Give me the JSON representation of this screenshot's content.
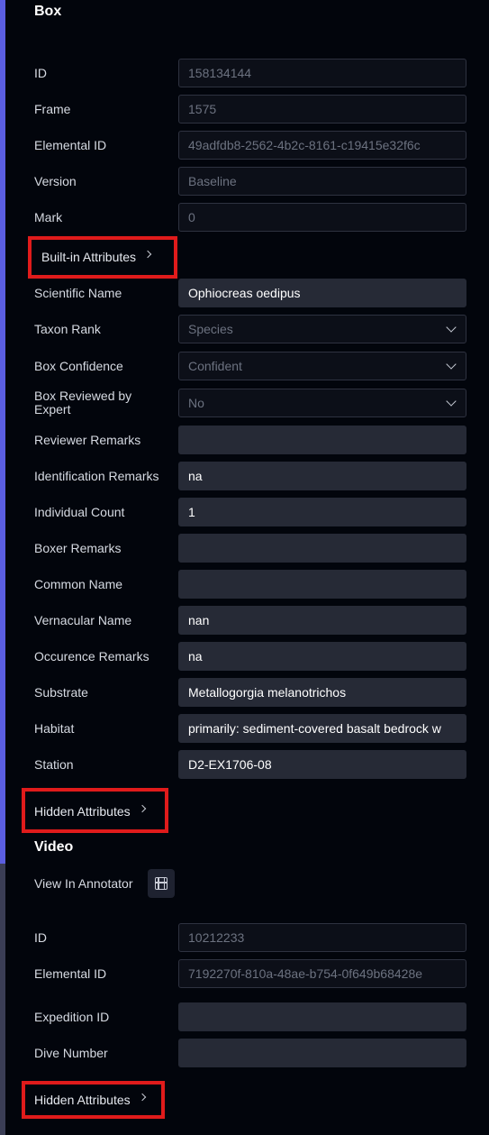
{
  "box": {
    "title": "Box",
    "readonly_fields": [
      {
        "label": "ID",
        "value": "158134144"
      },
      {
        "label": "Frame",
        "value": "1575"
      },
      {
        "label": "Elemental ID",
        "value": "49adfdb8-2562-4b2c-8161-c19415e32f6c"
      },
      {
        "label": "Version",
        "value": "Baseline"
      },
      {
        "label": "Mark",
        "value": "0"
      }
    ],
    "builtin_toggle": "Built-in Attributes",
    "attributes": [
      {
        "label": "Scientific Name",
        "value": "Ophiocreas oedipus"
      },
      {
        "label": "Taxon Rank",
        "value": "Species"
      },
      {
        "label": "Box Confidence",
        "value": "Confident"
      },
      {
        "label": "Box Reviewed by Expert",
        "value": "No"
      },
      {
        "label": "Reviewer Remarks",
        "value": ""
      },
      {
        "label": "Identification Remarks",
        "value": "na"
      },
      {
        "label": "Individual Count",
        "value": "1"
      },
      {
        "label": "Boxer Remarks",
        "value": ""
      },
      {
        "label": "Common Name",
        "value": ""
      },
      {
        "label": "Vernacular Name",
        "value": "nan"
      },
      {
        "label": "Occurence Remarks",
        "value": "na"
      },
      {
        "label": "Substrate",
        "value": "Metallogorgia melanotrichos"
      },
      {
        "label": "Habitat",
        "value": "primarily: sediment-covered basalt bedrock w"
      },
      {
        "label": "Station",
        "value": "D2-EX1706-08"
      }
    ],
    "hidden_toggle": "Hidden Attributes"
  },
  "video": {
    "title": "Video",
    "view_in_annotator": "View In Annotator",
    "readonly_fields": [
      {
        "label": "ID",
        "value": "10212233"
      },
      {
        "label": "Elemental ID",
        "value": "7192270f-810a-48ae-b754-0f649b68428e"
      }
    ],
    "attributes": [
      {
        "label": "Expedition ID",
        "value": ""
      },
      {
        "label": "Dive Number",
        "value": ""
      }
    ],
    "hidden_toggle": "Hidden Attributes"
  },
  "icons": {
    "annotator": "film-icon",
    "expand": "chevron-right-icon",
    "dropdown": "chevron-down-icon"
  },
  "colors": {
    "accent": "#5b5ee0",
    "highlight_box": "#e01b1b",
    "background": "#02050c"
  }
}
